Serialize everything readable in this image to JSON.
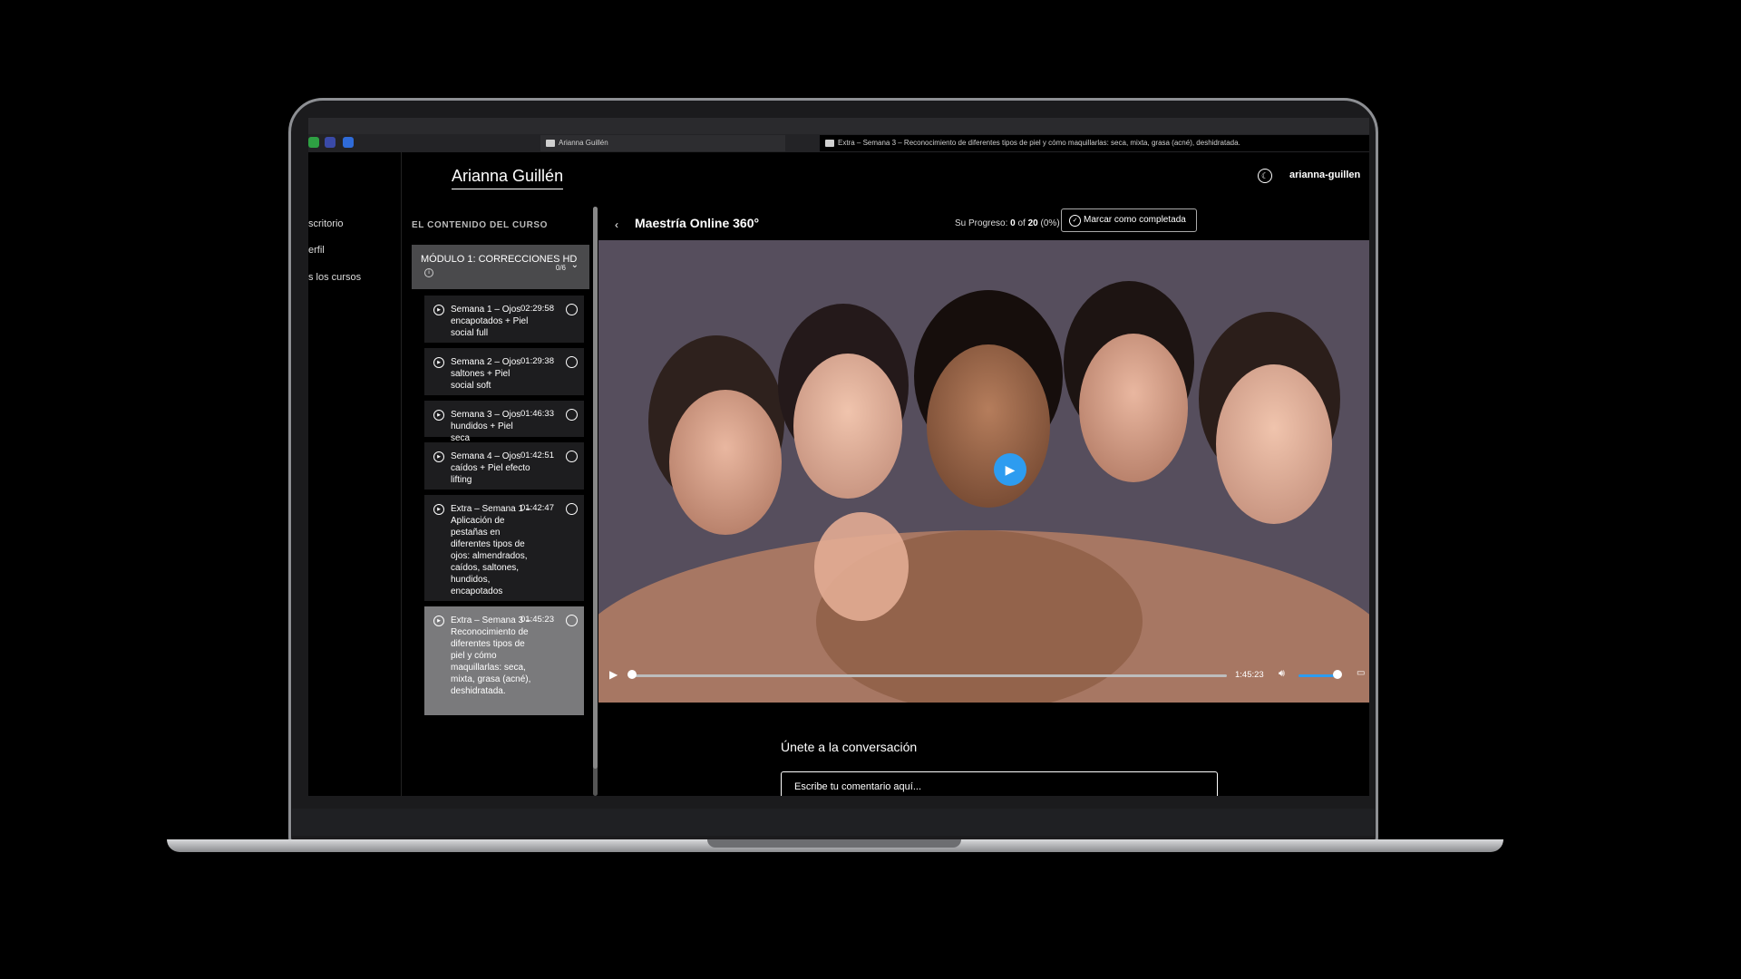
{
  "browser": {
    "tabs": [
      {
        "label": "Arianna Guillén",
        "active": false
      },
      {
        "label": "Extra – Semana 3 – Reconocimiento de diferentes tipos de piel y cómo maquillarlas: seca, mixta, grasa (acné), deshidratada.",
        "active": true
      }
    ]
  },
  "header": {
    "logo": "Arianna Guillén",
    "user": "arianna-guillen"
  },
  "nav": {
    "items": [
      "scritorio",
      "erfil",
      "s los cursos"
    ]
  },
  "sidebar": {
    "title": "EL CONTENIDO DEL CURSO",
    "module": {
      "title": "MÓDULO 1: CORRECCIONES HD",
      "count": "0/6"
    },
    "lessons": [
      {
        "title": "Semana 1 – Ojos encapotados + Piel social full",
        "time": "02:29:58"
      },
      {
        "title": "Semana 2 – Ojos saltones + Piel social soft",
        "time": "01:29:38"
      },
      {
        "title": "Semana 3 – Ojos hundidos + Piel seca",
        "time": "01:46:33"
      },
      {
        "title": "Semana 4 – Ojos caídos + Piel efecto lifting",
        "time": "01:42:51"
      },
      {
        "title": "Extra – Semana 1 – Aplicación de pestañas en diferentes tipos de ojos: almendrados, caídos, saltones, hundidos, encapotados",
        "time": "01:42:47"
      },
      {
        "title": "Extra – Semana 3 – Reconocimiento de diferentes tipos de piel y cómo maquillarlas: seca, mixta, grasa (acné), deshidratada.",
        "time": "01:45:23"
      }
    ]
  },
  "main": {
    "course_title": "Maestría Online 360°",
    "progress_label": "Su Progreso:",
    "progress_done": "0",
    "progress_of": "of",
    "progress_total": "20",
    "progress_pct": "(0%)",
    "complete_button": "Marcar como completada",
    "video": {
      "duration": "1:45:23",
      "progress": 0.0,
      "volume": 0.85
    },
    "conversation_title": "Únete a la conversación",
    "comment_placeholder": "Escribe tu comentario aquí..."
  },
  "colors": {
    "accent": "#2d9cf0",
    "background": "#000000",
    "active_lesson": "#7a7a7c",
    "module_bg": "#4a4a4c"
  }
}
